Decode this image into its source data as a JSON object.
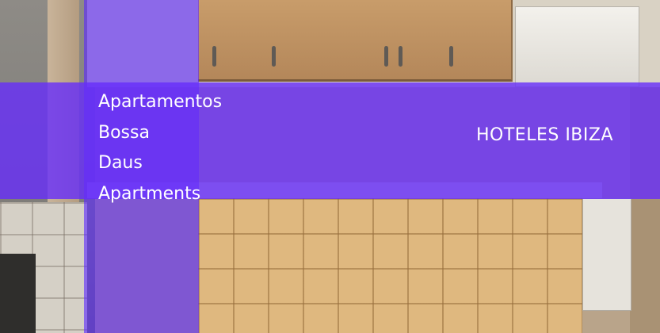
{
  "hotel": {
    "name_lines": [
      "Apartamentos",
      "Bossa",
      "Daus",
      "Apartments"
    ]
  },
  "brand": {
    "label": "HOTELES IBIZA"
  },
  "colors": {
    "overlay": "#5c28ff",
    "text": "#ffffff"
  }
}
